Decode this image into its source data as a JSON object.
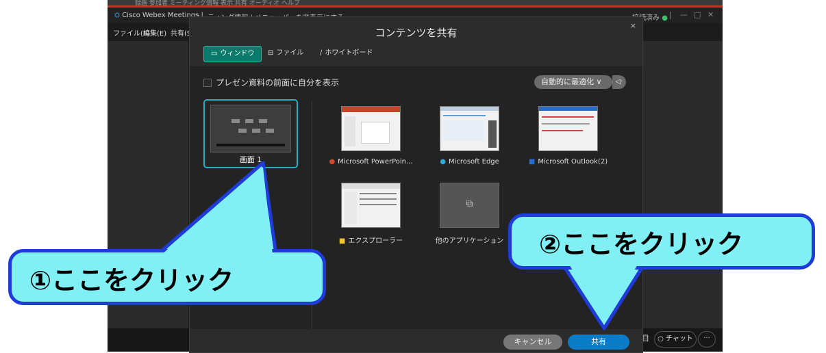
{
  "app": {
    "top_strip_text": "録画 参加者 ミーティング情報 表示 共有 オーディオ ヘルプ",
    "logo_symbol": "⛭",
    "title": "Cisco Webex Meetings",
    "second_tab": "ミーティング情報 | メニューバーを非表示にする",
    "status": "接続済み",
    "status_dot": "●",
    "menu": [
      "ファイル(F)",
      "編集(E)",
      "共有(S)"
    ],
    "window_controls": [
      "|",
      "—",
      "□",
      "✕"
    ],
    "bottom_partial": "目",
    "chat_label": "○ チャット",
    "more_label": "···"
  },
  "dialog": {
    "title": "コンテンツを共有",
    "close": "×",
    "tabs": [
      {
        "icon": "▭",
        "label": "ウィンドウ"
      },
      {
        "icon": "⊟",
        "label": "ファイル"
      },
      {
        "icon": "∕",
        "label": "ホワイトボード"
      }
    ],
    "present_label": "プレゼン資料の前面に自分を表示",
    "optimize_label": "自動的に最適化 ∨",
    "sound_icon": "◁·",
    "screen_label": "画面 1",
    "apps": [
      {
        "label": "Microsoft PowerPoin...",
        "icon": "●",
        "icon_color": "#d24726"
      },
      {
        "label": "Microsoft Edge",
        "icon": "●",
        "icon_color": "#2fa8d8"
      },
      {
        "label": "Microsoft Outlook(2)",
        "icon": "■",
        "icon_color": "#1e6fd0"
      },
      {
        "label": "エクスプローラー",
        "icon": "■",
        "icon_color": "#f3c13a"
      },
      {
        "label": "他のアプリケーション",
        "icon": "",
        "icon_color": ""
      }
    ],
    "other_app_icon": "⧉",
    "cancel_label": "キャンセル",
    "share_label": "共有"
  },
  "callouts": {
    "first": "①ここをクリック",
    "second": "②ここをクリック"
  },
  "colors": {
    "accent": "#0a7a6a",
    "share_blue": "#0b7cc7",
    "callout_fill": "#80f0f4",
    "callout_border": "#1f3cd8",
    "selected_border": "#1fb3c5"
  }
}
